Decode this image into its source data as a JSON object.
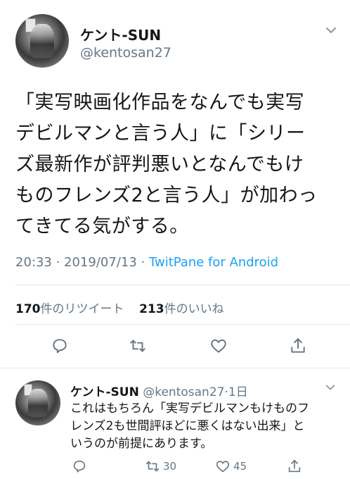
{
  "main_tweet": {
    "display_name": "ケント-SUN",
    "handle": "@kentosan27",
    "text_lines": [
      "「実写映画化作品をなんでも実写",
      "デビルマンと言う人」に「シリー",
      "ズ最新作が評判悪いとなんでもけ",
      "ものフレンズ2と言う人」が加わっ",
      "てきてる気がする。"
    ],
    "time": "20:33",
    "date": "2019/07/13",
    "separator": " · ",
    "client": "TwitPane for Android",
    "retweet_count": "170",
    "retweet_label": "件のリツイート",
    "like_count": "213",
    "like_label": "件のいいね"
  },
  "reply_tweet": {
    "display_name": "ケント-SUN",
    "handle": "@kentosan27",
    "separator": "·",
    "age": "1日",
    "text_lines": [
      "これはもちろん「実写デビルマンもけものフ",
      "レンズ2も世間評ほどに悪くはない出来」と",
      "いうのが前提にあります。"
    ],
    "retweets": "30",
    "likes": "45"
  },
  "colors": {
    "text": "#14171a",
    "secondary": "#657786",
    "link": "#1da1f2",
    "divider": "#e1e8ed"
  },
  "icons": [
    "chevron-down-icon",
    "reply-icon",
    "retweet-icon",
    "like-icon",
    "share-icon"
  ]
}
